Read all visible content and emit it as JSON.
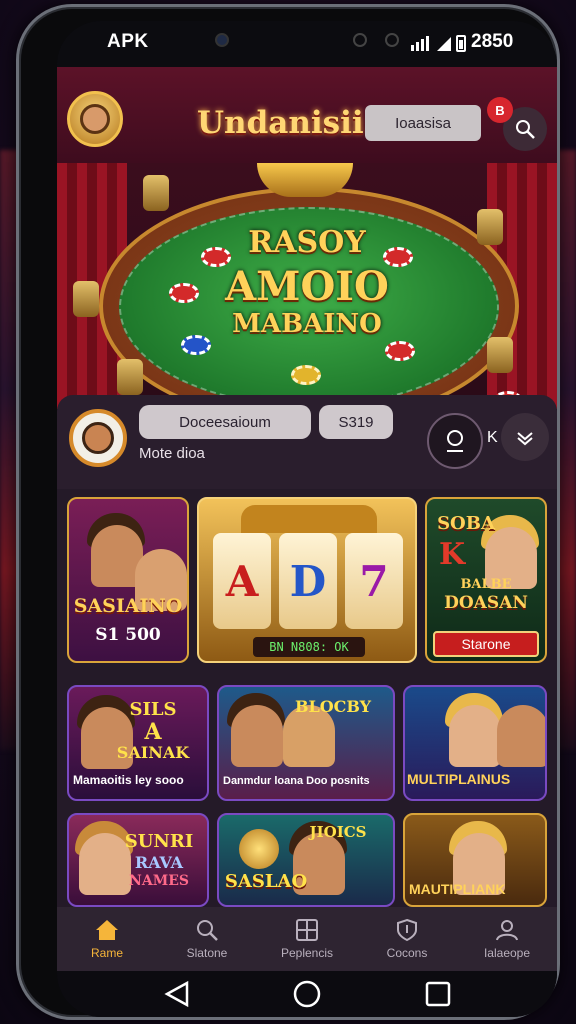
{
  "status_bar": {
    "carrier": "APK",
    "time": "2850"
  },
  "header": {
    "brand": "Undanisii",
    "pill_label": "Ioaasisa",
    "notification_badge": "B"
  },
  "banner": {
    "line1": "RASOY",
    "line2": "AMOIO",
    "line3": "MABAINO"
  },
  "player_card": {
    "name_pill": "Doceesaioum",
    "amount_pill": "S319",
    "subtitle": "Mote dioa",
    "side_letter": "K"
  },
  "games": {
    "row1": [
      {
        "title": "SASIAINO",
        "subtitle": "S1 500"
      },
      {
        "reels": [
          "A",
          "D",
          "7"
        ],
        "display": "BN   N808: OK"
      },
      {
        "title_a": "SOBA",
        "title_b": "K",
        "title_c": "BALBE",
        "title_d": "DOASAN",
        "button": "Starone"
      }
    ],
    "row2": [
      {
        "title_a": "SILS",
        "title_b": "A",
        "title_c": "SAINAK",
        "caption": "Mamaoitis ley sooo"
      },
      {
        "title_a": "BLOCBY",
        "caption": "Danmdur loana Doo posnits"
      },
      {
        "caption": "MULTIPLAINUS"
      }
    ],
    "row3": [
      {
        "title_a": "SUNRI",
        "title_b": "RAVA",
        "title_c": "NAMES"
      },
      {
        "title_a": "JIOICS",
        "title_b": "SASLAO"
      },
      {
        "caption": "MAUTIPLIANK"
      }
    ]
  },
  "bottom_nav": [
    {
      "label": "Rame",
      "icon": "home-icon",
      "active": true
    },
    {
      "label": "Slatone",
      "icon": "search-icon",
      "active": false
    },
    {
      "label": "Peplencis",
      "icon": "grid-icon",
      "active": false
    },
    {
      "label": "Cocons",
      "icon": "shield-icon",
      "active": false
    },
    {
      "label": "Ialaeope",
      "icon": "user-icon",
      "active": false
    }
  ],
  "colors": {
    "accent": "#f5b53a",
    "header_bg": "#5c1228",
    "felt": "#2e8f3a",
    "nav_bg": "#2e2431"
  }
}
